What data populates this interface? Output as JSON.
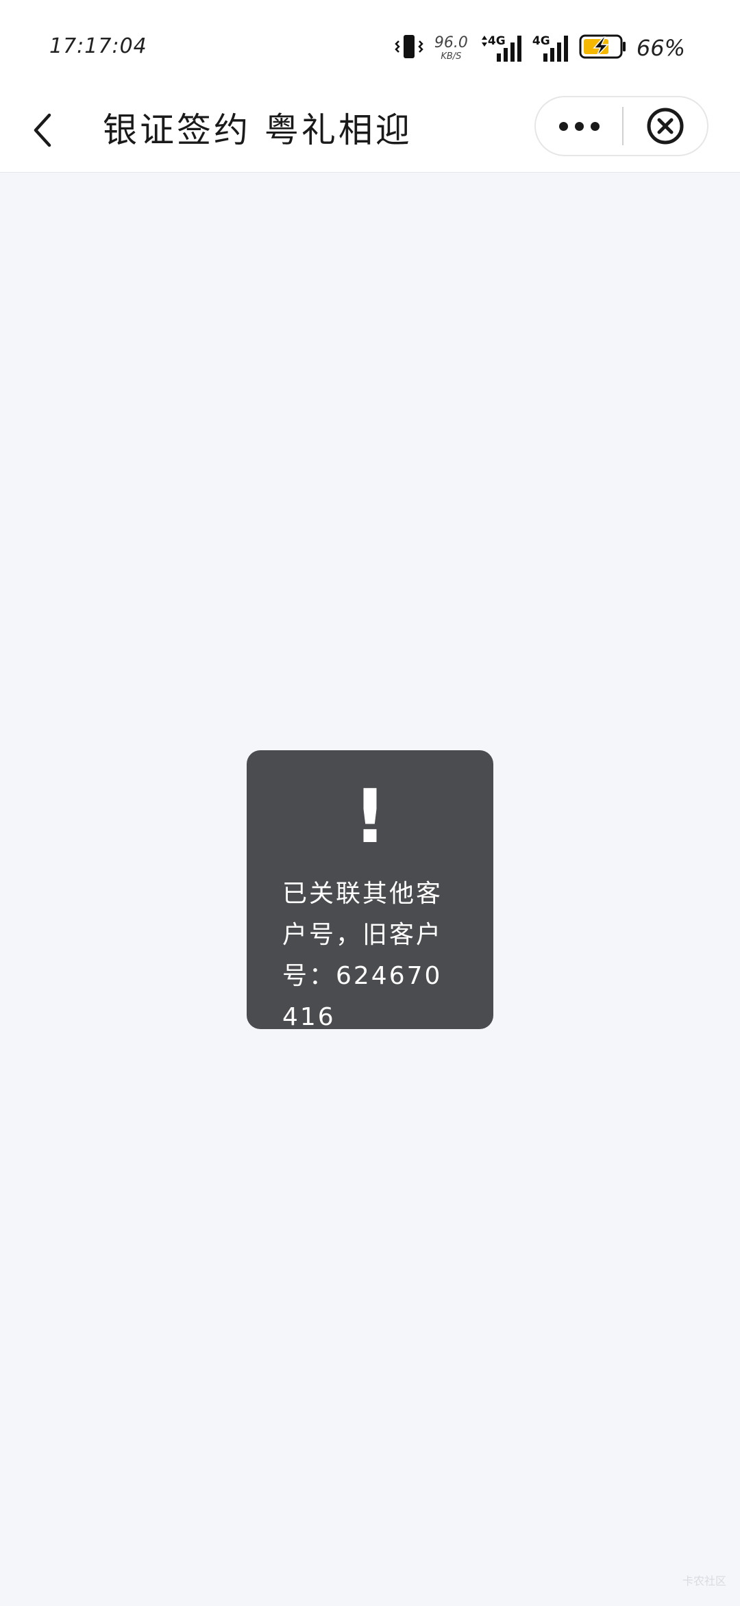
{
  "status_bar": {
    "time": "17:17:04",
    "net_speed_value": "96.0",
    "net_speed_unit": "KB/S",
    "signal1_label": "4G",
    "signal2_label": "4G",
    "battery_percent": "66%",
    "battery_color": "#F5B800"
  },
  "nav": {
    "title": "银证签约 粤礼相迎"
  },
  "toast": {
    "icon_text": "!",
    "message": "已关联其他客户号，旧客户号：624670416"
  },
  "watermark": "卡农社区"
}
